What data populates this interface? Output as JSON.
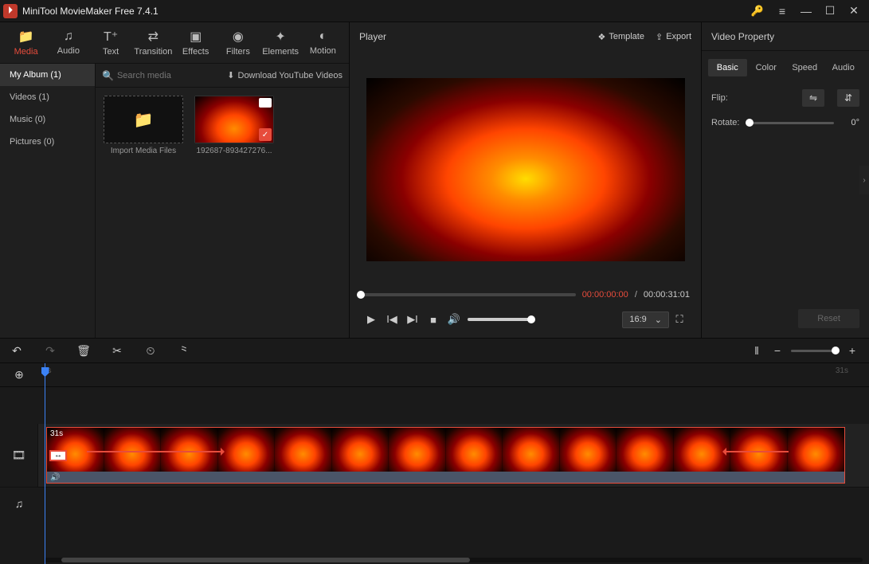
{
  "app": {
    "title": "MiniTool MovieMaker Free 7.4.1"
  },
  "tabs": [
    {
      "label": "Media",
      "icon": "folder"
    },
    {
      "label": "Audio",
      "icon": "music"
    },
    {
      "label": "Text",
      "icon": "text"
    },
    {
      "label": "Transition",
      "icon": "transition"
    },
    {
      "label": "Effects",
      "icon": "effects"
    },
    {
      "label": "Filters",
      "icon": "filters"
    },
    {
      "label": "Elements",
      "icon": "elements"
    },
    {
      "label": "Motion",
      "icon": "motion"
    }
  ],
  "sidebar": {
    "items": [
      {
        "label": "My Album (1)"
      },
      {
        "label": "Videos (1)"
      },
      {
        "label": "Music (0)"
      },
      {
        "label": "Pictures (0)"
      }
    ]
  },
  "library": {
    "search_placeholder": "Search media",
    "download_label": "Download YouTube Videos",
    "import_label": "Import Media Files",
    "media_items": [
      {
        "name": "192687-893427276..."
      }
    ]
  },
  "player": {
    "title": "Player",
    "template_label": "Template",
    "export_label": "Export",
    "time_current": "00:00:00:00",
    "time_total": "00:00:31:01",
    "aspect": "16:9"
  },
  "properties": {
    "title": "Video Property",
    "tabs": [
      "Basic",
      "Color",
      "Speed",
      "Audio"
    ],
    "flip_label": "Flip:",
    "rotate_label": "Rotate:",
    "rotate_value": "0°",
    "reset_label": "Reset"
  },
  "timeline": {
    "ruler_start": "0s",
    "ruler_end": "31s",
    "clip_duration": "31s"
  }
}
